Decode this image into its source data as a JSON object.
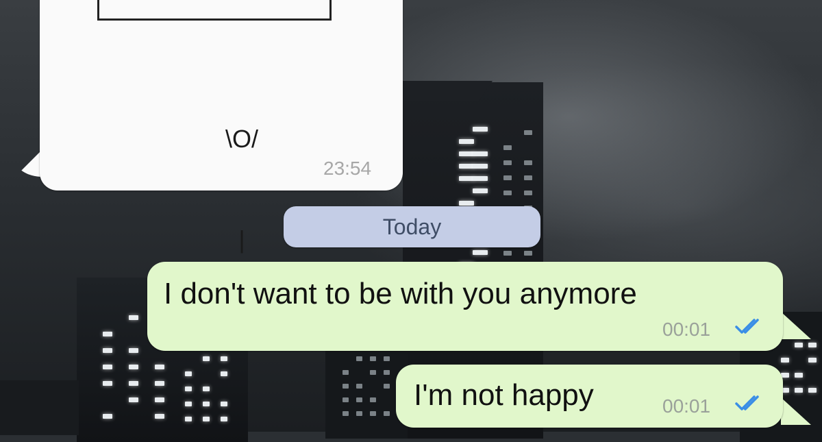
{
  "conversation": {
    "incoming": {
      "ascii_art_lines": [
        "\\O/",
        "|",
        "/ \\"
      ],
      "time": "23:54"
    },
    "date_divider": "Today",
    "outgoing": [
      {
        "text": "I don't want to be with you anymore",
        "time": "00:01",
        "status_icon": "double-check-read-icon"
      },
      {
        "text": "I'm not happy",
        "time": "00:01",
        "status_icon": "double-check-read-icon"
      }
    ]
  },
  "colors": {
    "incoming_bubble": "#fafafa",
    "outgoing_bubble": "#e1f7cb",
    "date_pill": "#c4cde6",
    "read_ticks": "#3a8ee6"
  }
}
